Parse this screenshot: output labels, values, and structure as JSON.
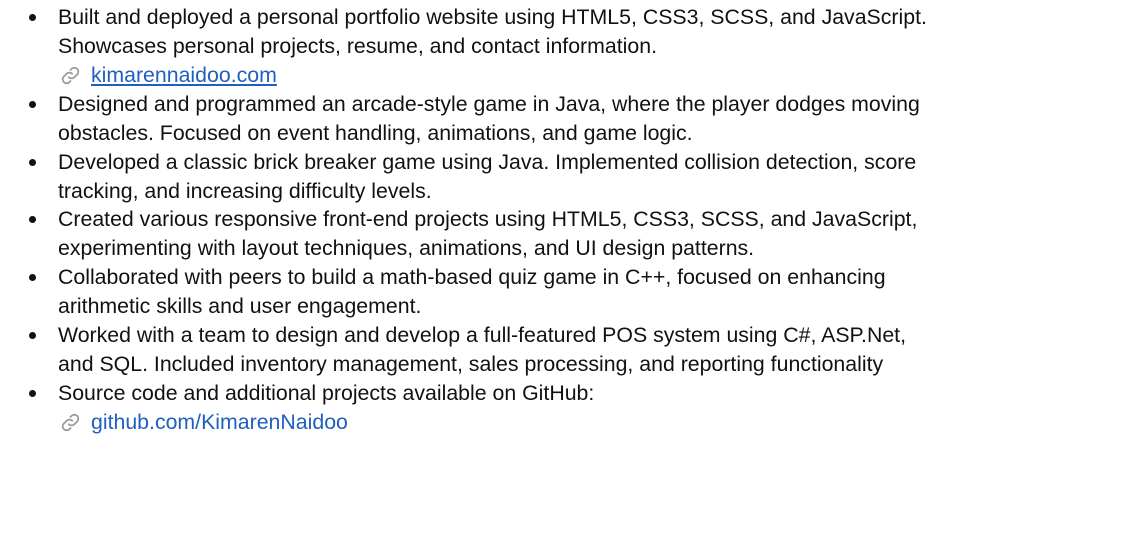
{
  "projects": [
    {
      "lines": [
        "Built and deployed a personal portfolio website using HTML5, CSS3, SCSS, and JavaScript.",
        "Showcases personal projects, resume, and contact information."
      ],
      "link": {
        "text": "kimarennaidoo.com",
        "icon": "link-icon"
      }
    },
    {
      "lines": [
        "Designed and programmed an arcade-style game in Java, where the player dodges moving",
        "obstacles. Focused on event handling, animations, and game logic."
      ]
    },
    {
      "lines": [
        "Developed a classic brick breaker game using Java. Implemented collision detection, score",
        "tracking, and increasing difficulty levels."
      ]
    },
    {
      "lines": [
        "Created various responsive front-end projects using HTML5, CSS3, SCSS, and JavaScript,",
        "experimenting with layout techniques, animations, and UI design patterns."
      ]
    },
    {
      "lines": [
        "Collaborated with peers to build a math-based quiz game in C++, focused on enhancing",
        "arithmetic skills and user engagement."
      ]
    },
    {
      "lines": [
        "Worked with a team to design and develop a full-featured POS system using C#, ASP.Net,",
        "and SQL. Included inventory management, sales processing, and reporting functionality"
      ]
    },
    {
      "lines": [
        "Source code and additional projects available on GitHub:"
      ],
      "link": {
        "text": "github.com/KimarenNaidoo",
        "icon": "link-icon"
      }
    }
  ],
  "colors": {
    "text": "#111111",
    "link": "#1f5fbf",
    "icon": "#9a9a9a"
  }
}
